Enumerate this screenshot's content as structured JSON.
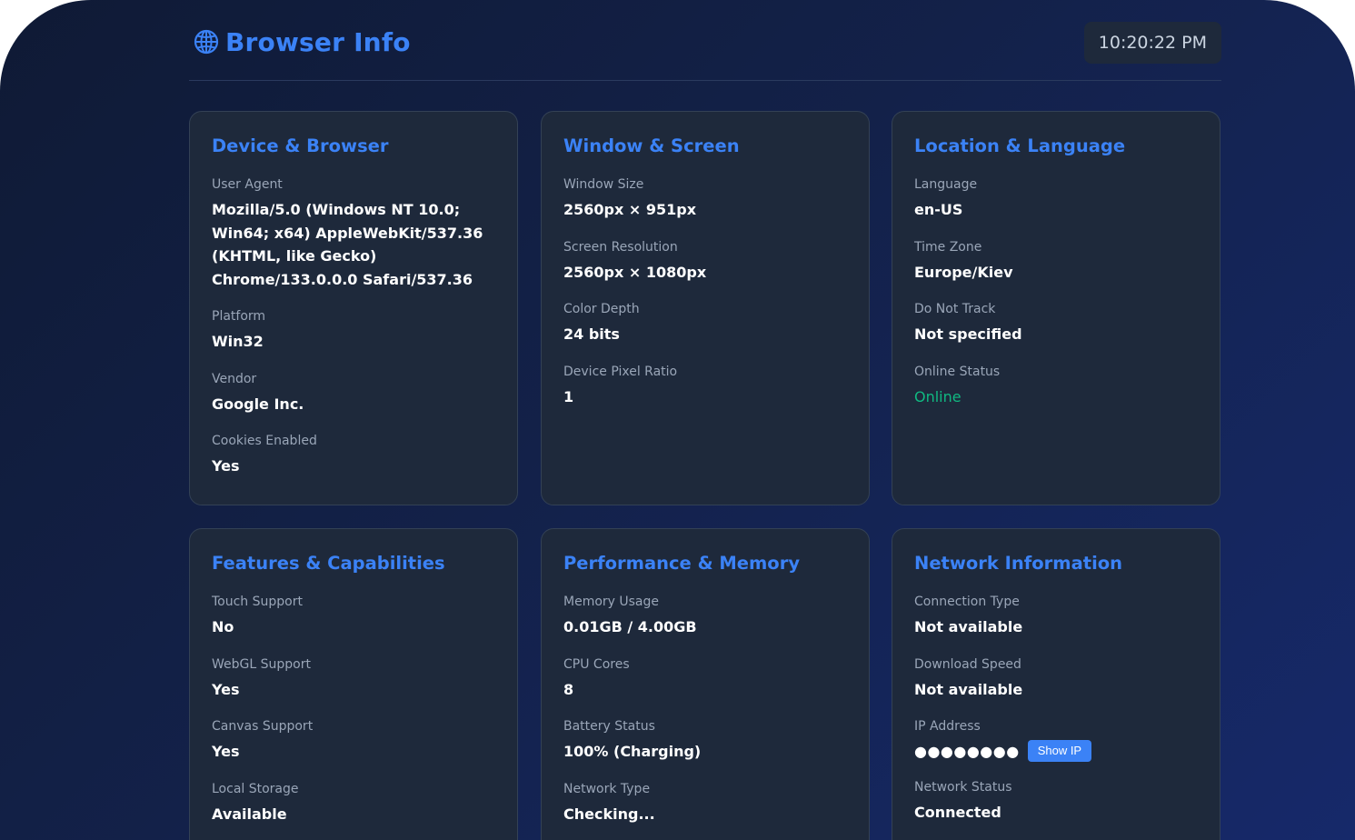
{
  "header": {
    "title": "Browser Info",
    "clock": "10:20:22 PM"
  },
  "colors": {
    "accent": "#3b82f6",
    "online": "#10b981",
    "card_bg": "#1e293b"
  },
  "cards": [
    {
      "title": "Device & Browser",
      "fields": [
        {
          "label": "User Agent",
          "value": "Mozilla/5.0 (Windows NT 10.0; Win64; x64) AppleWebKit/537.36 (KHTML, like Gecko) Chrome/133.0.0.0 Safari/537.36"
        },
        {
          "label": "Platform",
          "value": "Win32"
        },
        {
          "label": "Vendor",
          "value": "Google Inc."
        },
        {
          "label": "Cookies Enabled",
          "value": "Yes"
        }
      ]
    },
    {
      "title": "Window & Screen",
      "fields": [
        {
          "label": "Window Size",
          "value": "2560px × 951px"
        },
        {
          "label": "Screen Resolution",
          "value": "2560px × 1080px"
        },
        {
          "label": "Color Depth",
          "value": "24 bits"
        },
        {
          "label": "Device Pixel Ratio",
          "value": "1"
        }
      ]
    },
    {
      "title": "Location & Language",
      "fields": [
        {
          "label": "Language",
          "value": "en-US"
        },
        {
          "label": "Time Zone",
          "value": "Europe/Kiev"
        },
        {
          "label": "Do Not Track",
          "value": "Not specified"
        },
        {
          "label": "Online Status",
          "value": "Online"
        }
      ]
    },
    {
      "title": "Features & Capabilities",
      "fields": [
        {
          "label": "Touch Support",
          "value": "No"
        },
        {
          "label": "WebGL Support",
          "value": "Yes"
        },
        {
          "label": "Canvas Support",
          "value": "Yes"
        },
        {
          "label": "Local Storage",
          "value": "Available"
        }
      ]
    },
    {
      "title": "Performance & Memory",
      "fields": [
        {
          "label": "Memory Usage",
          "value": "0.01GB / 4.00GB"
        },
        {
          "label": "CPU Cores",
          "value": "8"
        },
        {
          "label": "Battery Status",
          "value": "100% (Charging)"
        },
        {
          "label": "Network Type",
          "value": "Checking..."
        }
      ]
    },
    {
      "title": "Network Information",
      "fields": [
        {
          "label": "Connection Type",
          "value": "Not available"
        },
        {
          "label": "Download Speed",
          "value": "Not available"
        },
        {
          "label": "IP Address",
          "value": "●●●●●●●●",
          "button": "Show IP"
        },
        {
          "label": "Network Status",
          "value": "Connected"
        }
      ]
    }
  ]
}
